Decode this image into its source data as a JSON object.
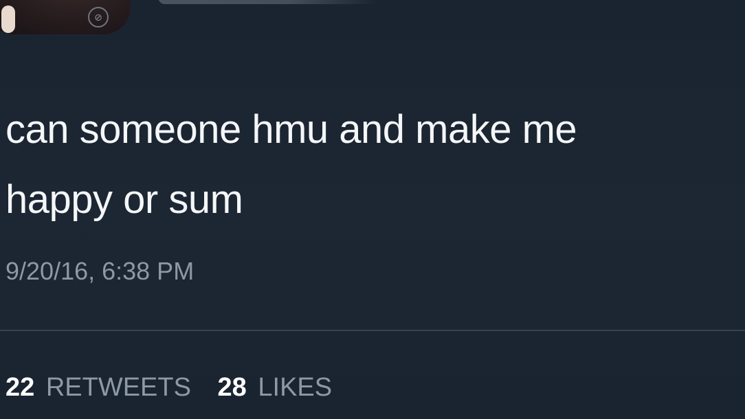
{
  "tweet": {
    "text": "can someone hmu and make me\nhappy or sum",
    "timestamp": "9/20/16, 6:38 PM",
    "retweets": {
      "count": "22",
      "label": "RETWEETS"
    },
    "likes": {
      "count": "28",
      "label": "LIKES"
    }
  },
  "colors": {
    "background": "#1b2632",
    "text": "#f4f6f8",
    "secondary_text": "#8d99a6",
    "divider": "#38434f"
  },
  "icons": {
    "avatar": "user-avatar",
    "badge": "verified-badge-icon"
  }
}
